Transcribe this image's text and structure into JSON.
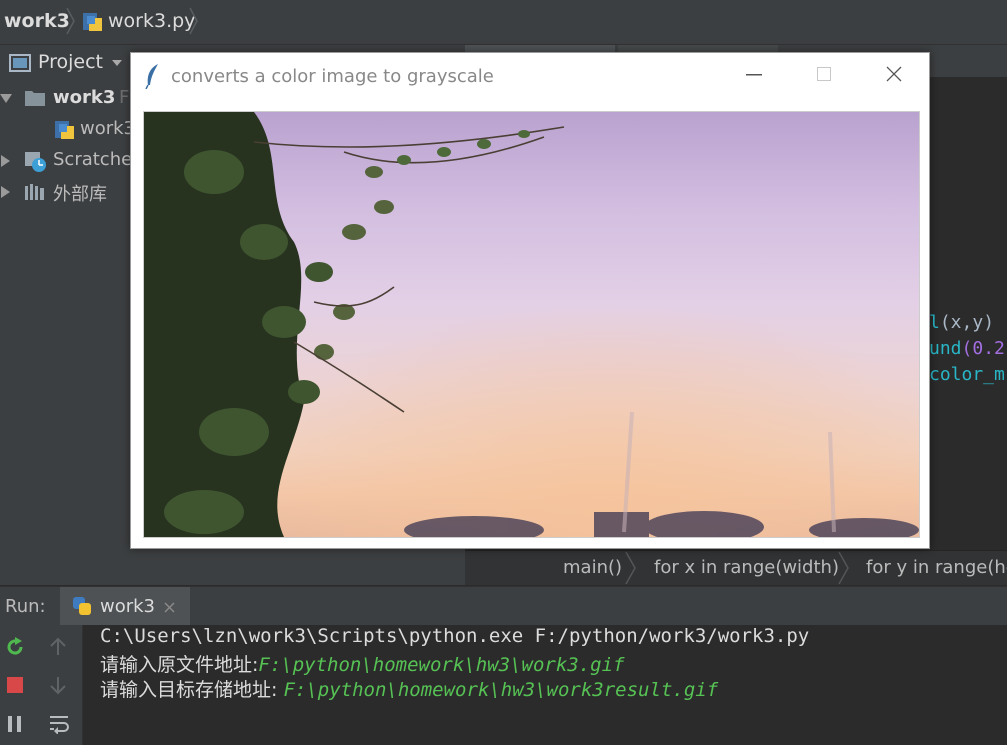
{
  "navbar": {
    "project": "work3",
    "file": "work3.py"
  },
  "project_panel": {
    "title": "Project",
    "items": [
      {
        "label": "work3",
        "suffix": "F"
      },
      {
        "label": "work3"
      },
      {
        "label": "Scratches"
      },
      {
        "label": "外部库"
      }
    ]
  },
  "editor": {
    "lines": [
      {
        "prefix": "l",
        "text": "(x,y)"
      },
      {
        "prefix": "und",
        "text": "(0.2"
      },
      {
        "prefix": "",
        "text": "color_m"
      }
    ]
  },
  "code_breadcrumbs": [
    "main()",
    "for x in range(width)",
    "for y in range(he"
  ],
  "run": {
    "label": "Run:",
    "tab": "work3",
    "console": {
      "command": "C:\\Users\\lzn\\work3\\Scripts\\python.exe F:/python/work3/work3.py",
      "prompt1": "请输入原文件地址:",
      "input1": "F:\\python\\homework\\hw3\\work3.gif",
      "prompt2": "请输入目标存储地址: ",
      "input2": "F:\\python\\homework\\hw3\\work3result.gif"
    }
  },
  "tk_window": {
    "title": "converts a color image to grayscale"
  },
  "colors": {
    "ide_bg": "#2b2b2b",
    "panel_bg": "#3c3f41",
    "console_input": "#56c254",
    "code_cyan": "#29b6c6",
    "code_purple": "#a26ee0"
  },
  "icons": [
    "python-file-icon",
    "folder-icon",
    "scratches-icon",
    "library-icon",
    "rerun-icon",
    "stop-icon",
    "pause-icon",
    "up-icon",
    "down-icon",
    "wrap-icon",
    "feather-icon"
  ]
}
